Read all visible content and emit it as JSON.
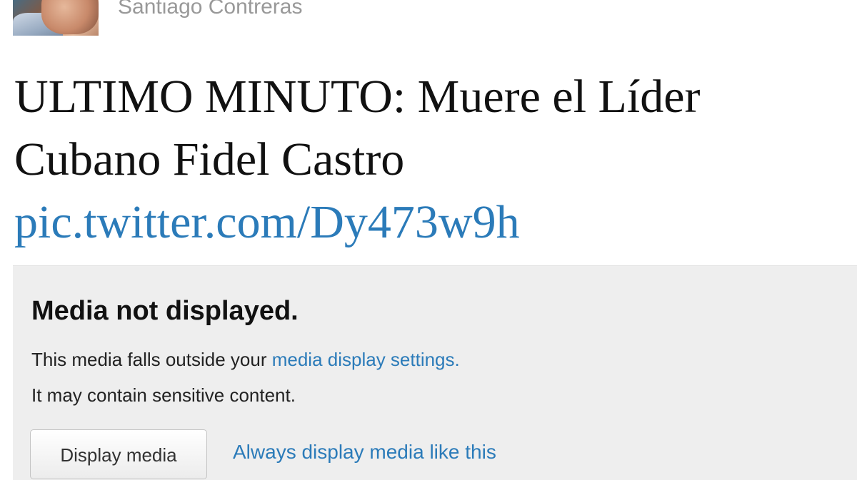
{
  "tweet": {
    "author_name": "Santiago Contreras",
    "text_line1": "ULTIMO MINUTO: Muere el Líder",
    "text_line2": "Cubano Fidel Castro",
    "link": "pic.twitter.com/Dy473w9h"
  },
  "media_notice": {
    "title": "Media not displayed.",
    "desc_prefix": "This media falls outside your ",
    "settings_link": "media display settings.",
    "desc_line2": "It may contain sensitive content.",
    "display_button": "Display media",
    "always_link": "Always display media like this"
  },
  "colors": {
    "link": "#2b7bb9",
    "panel_bg": "#eeeeee",
    "author": "#999999"
  }
}
